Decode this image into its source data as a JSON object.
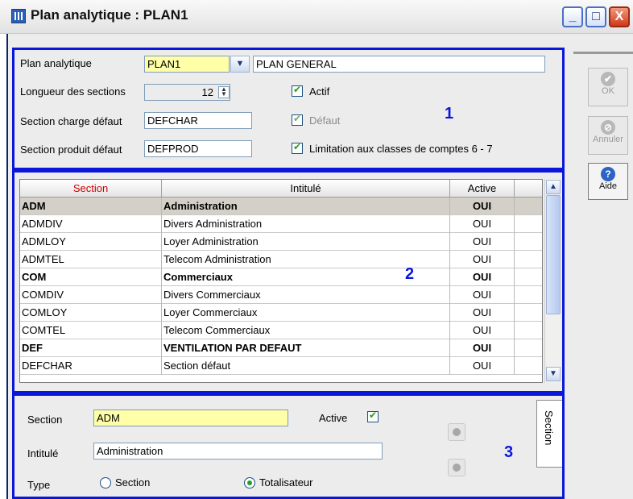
{
  "window": {
    "title": "Plan analytique : PLAN1",
    "min_label": "_",
    "max_label": "□",
    "close_label": "X"
  },
  "header": {
    "plan_label": "Plan analytique",
    "plan_code": "PLAN1",
    "plan_name": "PLAN GENERAL",
    "longueur_label": "Longueur des sections",
    "longueur_value": "12",
    "actif_label": "Actif",
    "charge_label": "Section charge défaut",
    "charge_value": "DEFCHAR",
    "defaut_label": "Défaut",
    "produit_label": "Section produit défaut",
    "produit_value": "DEFPROD",
    "limitation_label": "Limitation aux classes de comptes 6 - 7",
    "marker": "1"
  },
  "side_buttons": {
    "ok": "OK",
    "annuler": "Annuler",
    "aide": "Aide"
  },
  "grid": {
    "columns": [
      "Section",
      "Intitulé",
      "Active"
    ],
    "marker": "2",
    "rows": [
      {
        "section": "ADM",
        "intitule": "Administration",
        "active": "OUI",
        "bold": true
      },
      {
        "section": "ADMDIV",
        "intitule": "Divers Administration",
        "active": "OUI"
      },
      {
        "section": "ADMLOY",
        "intitule": "Loyer Administration",
        "active": "OUI"
      },
      {
        "section": "ADMTEL",
        "intitule": "Telecom Administration",
        "active": "OUI"
      },
      {
        "section": "COM",
        "intitule": "Commerciaux",
        "active": "OUI",
        "bold": true
      },
      {
        "section": "COMDIV",
        "intitule": "Divers Commerciaux",
        "active": "OUI"
      },
      {
        "section": "COMLOY",
        "intitule": "Loyer Commerciaux",
        "active": "OUI"
      },
      {
        "section": "COMTEL",
        "intitule": "Telecom Commerciaux",
        "active": "OUI"
      },
      {
        "section": "DEF",
        "intitule": "VENTILATION PAR DEFAUT",
        "active": "OUI",
        "bold": true
      },
      {
        "section": "DEFCHAR",
        "intitule": "Section défaut",
        "active": "OUI"
      }
    ]
  },
  "detail": {
    "section_label": "Section",
    "section_value": "ADM",
    "active_label": "Active",
    "intitule_label": "Intitulé",
    "intitule_value": "Administration",
    "type_label": "Type",
    "type_option_section": "Section",
    "type_option_totalisateur": "Totalisateur",
    "tab_label": "Section",
    "marker": "3"
  },
  "colors": {
    "frame": "#0b17d8",
    "section_header": "#d00000",
    "selected_row": "#d4d0c8"
  }
}
